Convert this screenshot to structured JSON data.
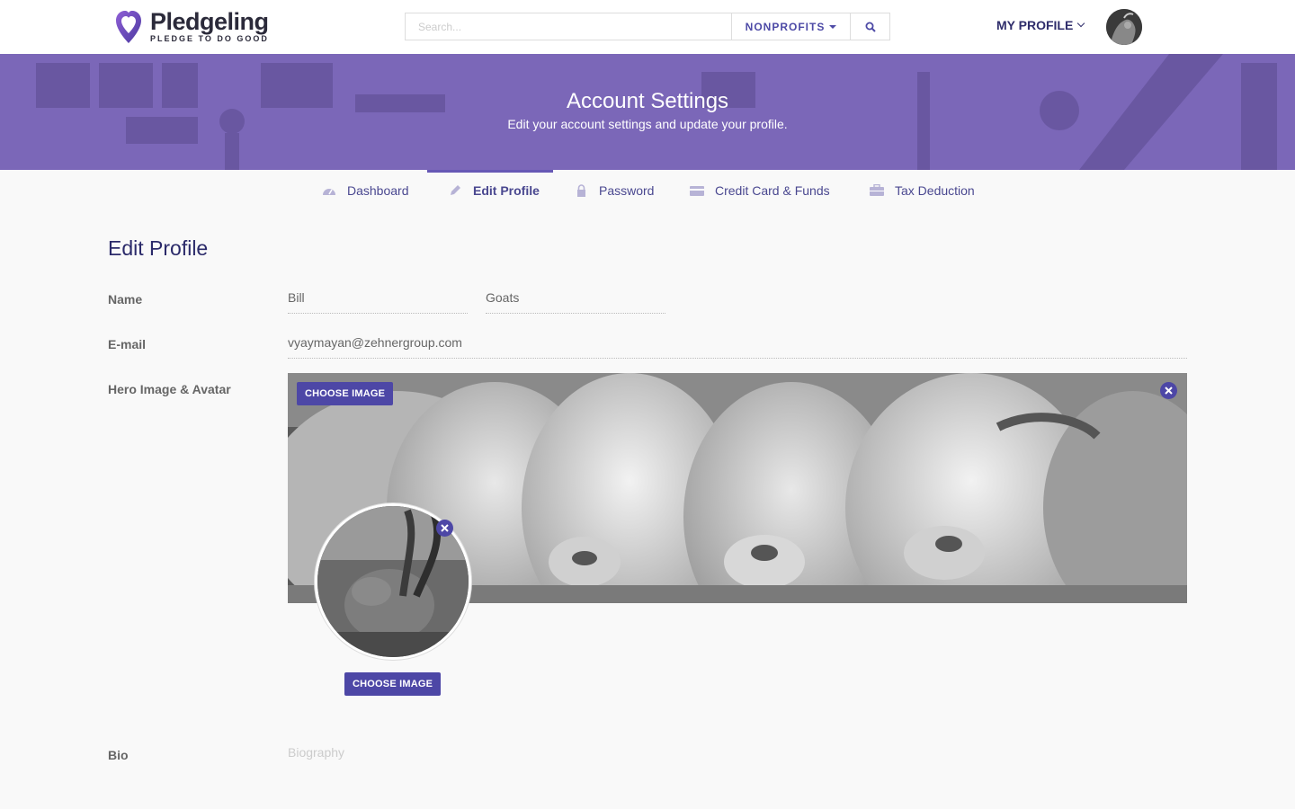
{
  "header": {
    "logo_name": "Pledgeling",
    "logo_tagline": "PLEDGE TO DO GOOD",
    "search_placeholder": "Search...",
    "nonprofits_label": "NONPROFITS",
    "profile_label": "MY PROFILE"
  },
  "banner": {
    "title": "Account Settings",
    "subtitle": "Edit your account settings and update your profile."
  },
  "tabs": [
    {
      "label": "Dashboard",
      "icon": "dashboard-icon"
    },
    {
      "label": "Edit Profile",
      "icon": "pencil-icon",
      "active": true
    },
    {
      "label": "Password",
      "icon": "lock-icon"
    },
    {
      "label": "Credit Card & Funds",
      "icon": "credit-card-icon"
    },
    {
      "label": "Tax Deduction",
      "icon": "briefcase-icon"
    }
  ],
  "form": {
    "title": "Edit Profile",
    "name_label": "Name",
    "first_name": "Bill",
    "last_name": "Goats",
    "email_label": "E-mail",
    "email": "vyaymayan@zehnergroup.com",
    "hero_label": "Hero Image & Avatar",
    "choose_image_hero": "CHOOSE IMAGE",
    "choose_image_avatar": "CHOOSE IMAGE",
    "bio_label": "Bio",
    "bio_placeholder": "Biography"
  },
  "colors": {
    "brand": "#4d47a6",
    "banner": "#7b67b8",
    "heading": "#2b2a6a"
  }
}
